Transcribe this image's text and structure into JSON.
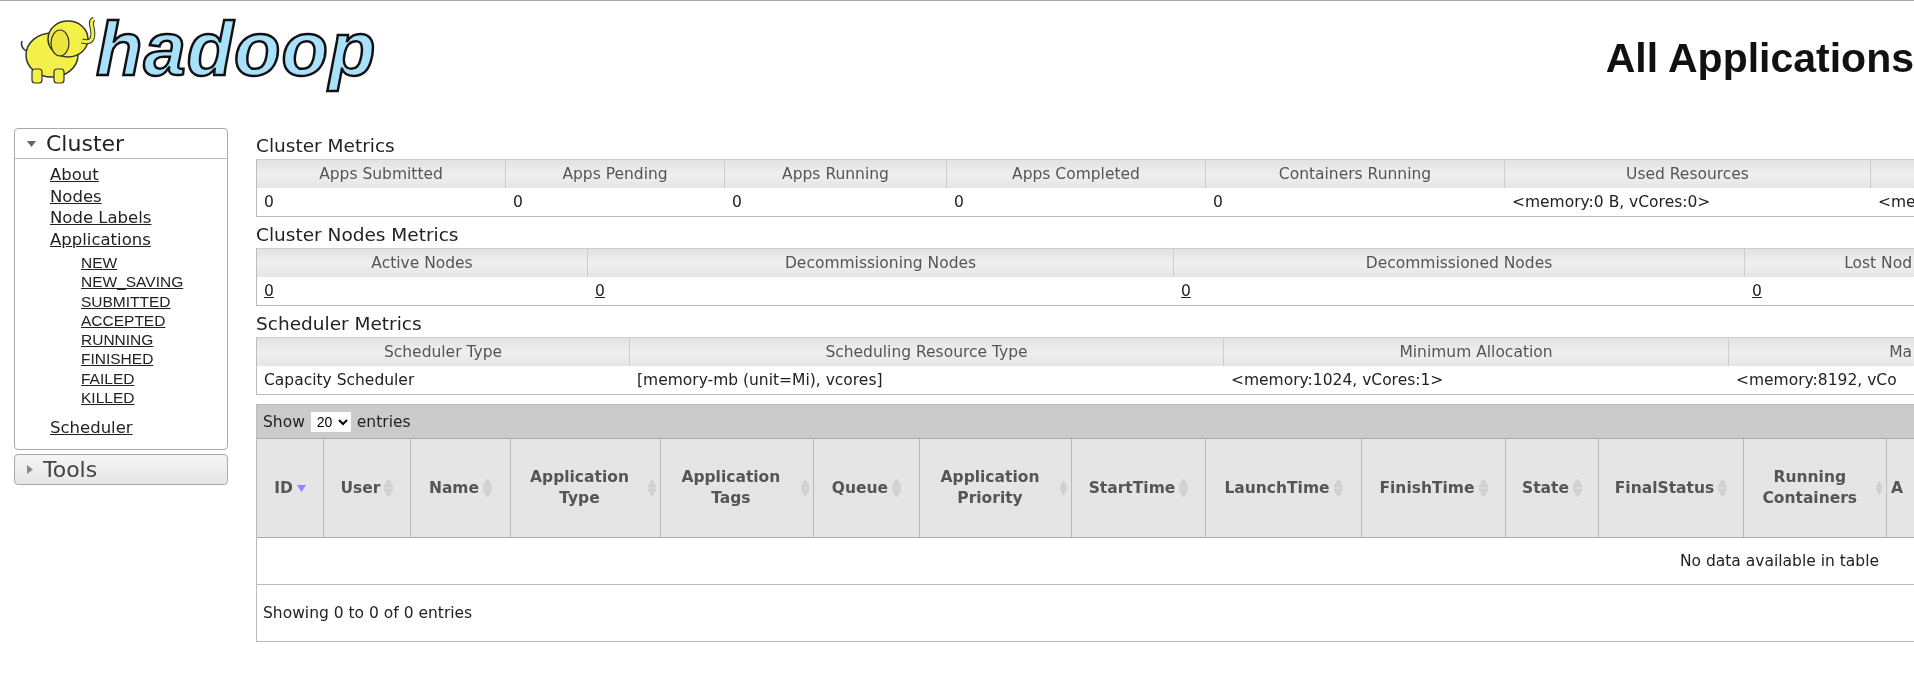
{
  "logo": {
    "text": "hadoop"
  },
  "page_title": "All Applications",
  "sidebar": [
    {
      "label": "Cluster",
      "expanded": true,
      "items": [
        {
          "label": "About"
        },
        {
          "label": "Nodes"
        },
        {
          "label": "Node Labels"
        },
        {
          "label": "Applications",
          "children": [
            {
              "label": "NEW"
            },
            {
              "label": "NEW_SAVING"
            },
            {
              "label": "SUBMITTED"
            },
            {
              "label": "ACCEPTED"
            },
            {
              "label": "RUNNING"
            },
            {
              "label": "FINISHED"
            },
            {
              "label": "FAILED"
            },
            {
              "label": "KILLED"
            }
          ]
        },
        {
          "label": "Scheduler"
        }
      ]
    },
    {
      "label": "Tools",
      "expanded": false
    }
  ],
  "metric_sections": [
    {
      "kind": "cluster",
      "title": "Cluster Metrics",
      "linked": false,
      "metrics": [
        {
          "label": "Apps Submitted",
          "value": "0"
        },
        {
          "label": "Apps Pending",
          "value": "0"
        },
        {
          "label": "Apps Running",
          "value": "0"
        },
        {
          "label": "Apps Completed",
          "value": "0"
        },
        {
          "label": "Containers Running",
          "value": "0"
        },
        {
          "label": "Used Resources",
          "value": "<memory:0 B, vCores:0>"
        },
        {
          "value": "<me"
        }
      ]
    },
    {
      "kind": "nodes",
      "title": "Cluster Nodes Metrics",
      "linked": true,
      "metrics": [
        {
          "label": "Active Nodes",
          "value": "0"
        },
        {
          "label": "Decommissioning Nodes",
          "value": "0"
        },
        {
          "label": "Decommissioned Nodes",
          "value": "0"
        },
        {
          "label": "Lost Nod",
          "value": "0"
        }
      ]
    },
    {
      "kind": "scheduler",
      "title": "Scheduler Metrics",
      "linked": false,
      "metrics": [
        {
          "label": "Scheduler Type",
          "value": "Capacity Scheduler"
        },
        {
          "label": "Scheduling Resource Type",
          "value": "[memory-mb (unit=Mi), vcores]"
        },
        {
          "label": "Minimum Allocation",
          "value": "<memory:1024, vCores:1>"
        },
        {
          "label": "Ma",
          "value": "<memory:8192, vCo"
        }
      ]
    }
  ],
  "applications": {
    "show_label": "Show",
    "page_size": "20",
    "entries_label": "entries",
    "columns": [
      {
        "label": "ID",
        "sorted": true
      },
      {
        "label": "User",
        "sorted": false
      },
      {
        "label": "Name",
        "sorted": false
      },
      {
        "label": "Application Type",
        "sorted": false
      },
      {
        "label": "Application Tags",
        "sorted": false
      },
      {
        "label": "Queue",
        "sorted": false
      },
      {
        "label": "Application Priority",
        "sorted": false
      },
      {
        "label": "StartTime",
        "sorted": false
      },
      {
        "label": "LaunchTime",
        "sorted": false
      },
      {
        "label": "FinishTime",
        "sorted": false
      },
      {
        "label": "State",
        "sorted": false
      },
      {
        "label": "FinalStatus",
        "sorted": false
      },
      {
        "label": "Running Containers",
        "sorted": false
      },
      {
        "label": "A"
      }
    ],
    "empty_message": "No data available in table",
    "footer": "Showing 0 to 0 of 0 entries"
  }
}
